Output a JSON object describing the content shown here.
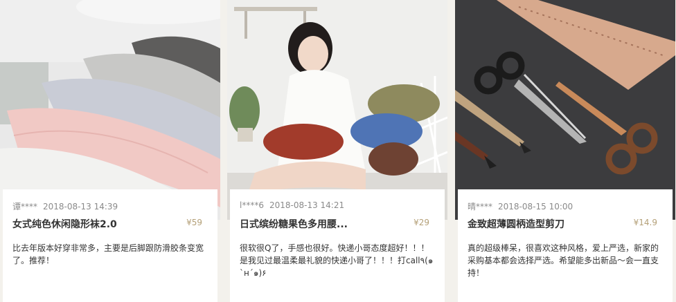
{
  "reviews": [
    {
      "user": "谭****",
      "date": "2018-08-13 14:39",
      "product": "女式纯色休闲隐形袜2.0",
      "price": "¥59",
      "text": "比去年版本好穿非常多，主要是后脚跟防滑胶条变宽了。推荐！",
      "image": "socks-photo"
    },
    {
      "user": "l****6",
      "date": "2018-08-13 14:21",
      "product": "日式缤纷糖果色多用腰...",
      "price": "¥29",
      "text": "很软很Q了，手感也很好。快递小哥态度超好！！！是我见过最温柔最礼貌的快递小哥了！！！打call٩(๑`н´๑)۶",
      "image": "pillow-photo"
    },
    {
      "user": "晴****",
      "date": "2018-08-15 10:00",
      "product": "金致超薄圆柄造型剪刀",
      "price": "¥14.9",
      "text": "真的超级棒呆，很喜欢这种风格，爱上严选，新家的采购基本都会选择严选。希望能多出新品～会一直支持！",
      "image": "scissors-photo"
    }
  ],
  "colors": {
    "background": "#f3f1ec",
    "price": "#b4a078",
    "meta": "#8a8a8a",
    "text": "#333333"
  }
}
